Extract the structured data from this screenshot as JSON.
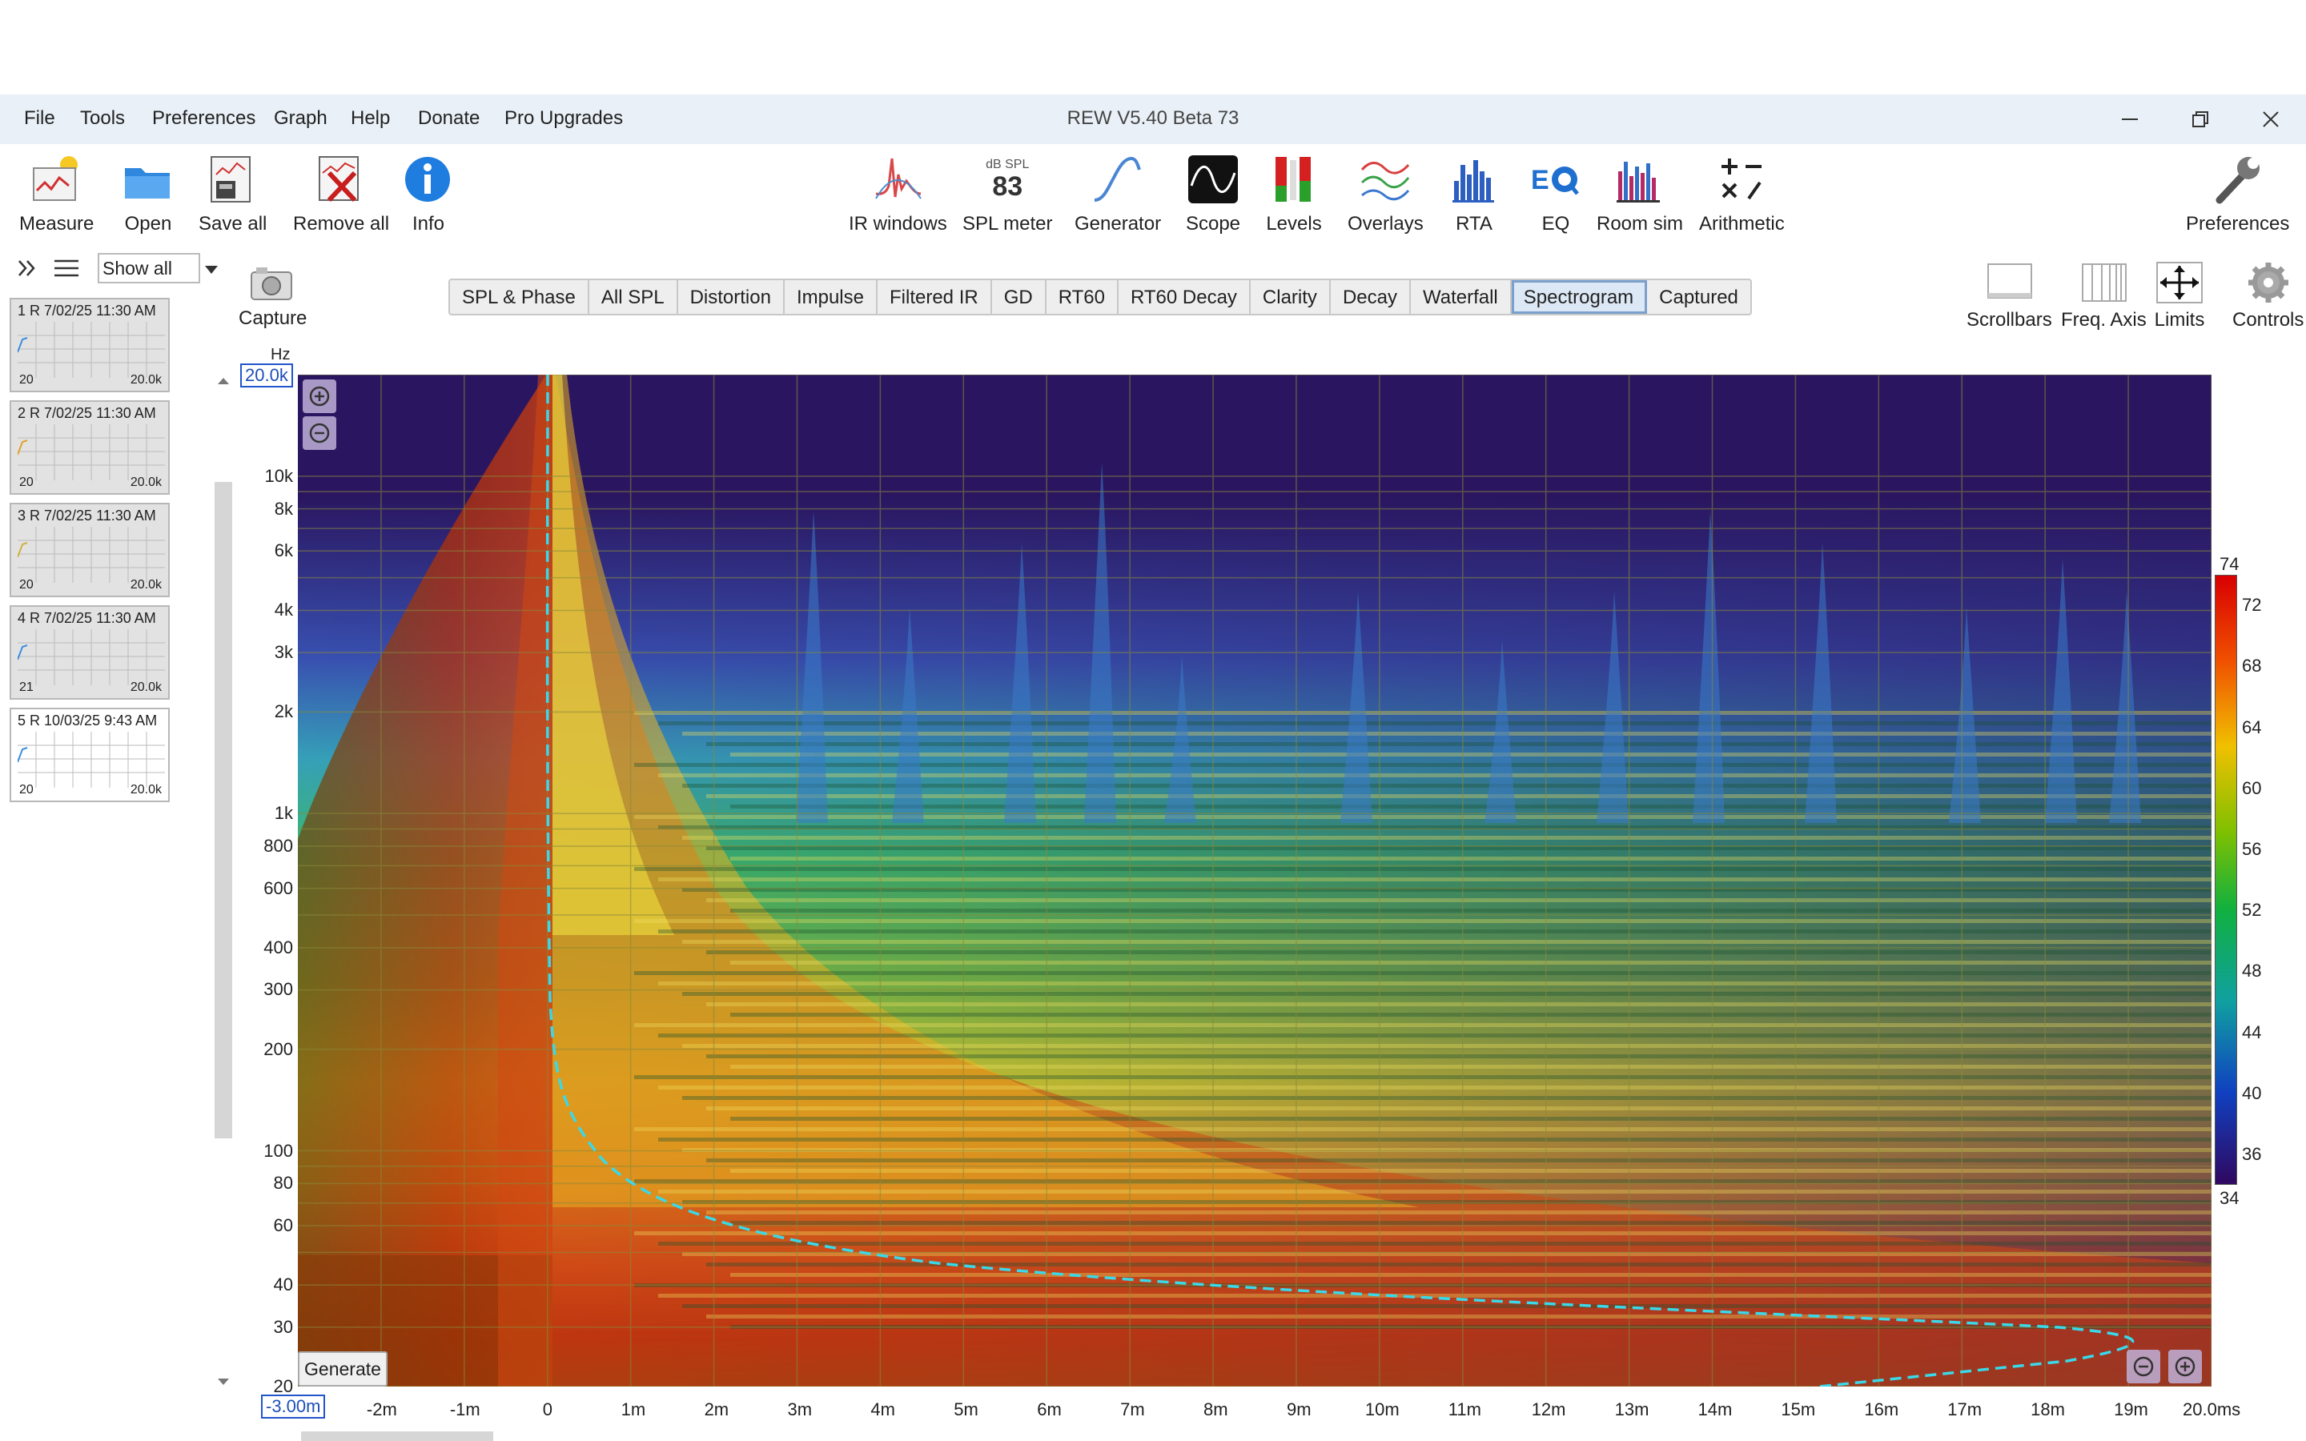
{
  "window": {
    "title": "REW V5.40 Beta 73"
  },
  "menu": [
    "File",
    "Tools",
    "Preferences",
    "Graph",
    "Help",
    "Donate",
    "Pro Upgrades"
  ],
  "toolbar_left": [
    {
      "label": "Measure",
      "icon": "measure-icon"
    },
    {
      "label": "Open",
      "icon": "open-folder-icon"
    },
    {
      "label": "Save all",
      "icon": "save-all-icon"
    },
    {
      "label": "Remove all",
      "icon": "remove-all-icon"
    },
    {
      "label": "Info",
      "icon": "info-icon"
    }
  ],
  "toolbar_center": [
    {
      "label": "IR windows",
      "icon": "ir-windows-icon"
    },
    {
      "label": "SPL meter",
      "icon": "spl-meter-icon",
      "top": "dB SPL",
      "value": "83"
    },
    {
      "label": "Generator",
      "icon": "generator-icon"
    },
    {
      "label": "Scope",
      "icon": "scope-icon"
    },
    {
      "label": "Levels",
      "icon": "levels-icon"
    },
    {
      "label": "Overlays",
      "icon": "overlays-icon"
    },
    {
      "label": "RTA",
      "icon": "rta-icon"
    },
    {
      "label": "EQ",
      "icon": "eq-icon"
    },
    {
      "label": "Room sim",
      "icon": "room-sim-icon"
    },
    {
      "label": "Arithmetic",
      "icon": "arithmetic-icon"
    }
  ],
  "toolbar_right": {
    "label": "Preferences",
    "icon": "preferences-wrench-icon"
  },
  "sidebar": {
    "show_all": "Show all",
    "capture_label": "Capture",
    "measurements": [
      {
        "num": "1",
        "ch": "R",
        "date": "7/02/25 11:30 AM",
        "low": "20",
        "high": "20.0k",
        "line": "#3b8de0"
      },
      {
        "num": "2",
        "ch": "R",
        "date": "7/02/25 11:30 AM",
        "low": "20",
        "high": "20.0k",
        "line": "#e0a030"
      },
      {
        "num": "3",
        "ch": "R",
        "date": "7/02/25 11:30 AM",
        "low": "20",
        "high": "20.0k",
        "line": "#d0b040"
      },
      {
        "num": "4",
        "ch": "R",
        "date": "7/02/25 11:30 AM",
        "low": "21",
        "high": "20.0k",
        "line": "#3b8de0"
      },
      {
        "num": "5",
        "ch": "R",
        "date": "10/03/25 9:43 AM",
        "low": "20",
        "high": "20.0k",
        "line": "#3b8de0",
        "selected": true
      }
    ]
  },
  "tabs": [
    "SPL & Phase",
    "All SPL",
    "Distortion",
    "Impulse",
    "Filtered IR",
    "GD",
    "RT60",
    "RT60 Decay",
    "Clarity",
    "Decay",
    "Waterfall",
    "Spectrogram",
    "Captured"
  ],
  "active_tab": "Spectrogram",
  "right_tools": [
    {
      "label": "Scrollbars",
      "icon": "scrollbars-icon"
    },
    {
      "label": "Freq. Axis",
      "icon": "freq-axis-icon"
    },
    {
      "label": "Limits",
      "icon": "limits-icon"
    },
    {
      "label": "Controls",
      "icon": "controls-gear-icon"
    }
  ],
  "graph": {
    "y_unit": "Hz",
    "y_top_value": "20.0k",
    "x_left_value": "-3.00m",
    "y_ticks": [
      "10k",
      "8k",
      "6k",
      "4k",
      "3k",
      "2k",
      "1k",
      "800",
      "600",
      "400",
      "300",
      "200",
      "100",
      "80",
      "60",
      "40",
      "30",
      "20"
    ],
    "x_ticks": [
      "-2m",
      "-1m",
      "0",
      "1m",
      "2m",
      "3m",
      "4m",
      "5m",
      "6m",
      "7m",
      "8m",
      "9m",
      "10m",
      "11m",
      "12m",
      "13m",
      "14m",
      "15m",
      "16m",
      "17m",
      "18m",
      "19m",
      "20.0ms"
    ],
    "colorbar_ticks": [
      "74",
      "72",
      "68",
      "64",
      "60",
      "56",
      "52",
      "48",
      "44",
      "40",
      "36",
      "34"
    ],
    "generate_label": "Generate"
  }
}
